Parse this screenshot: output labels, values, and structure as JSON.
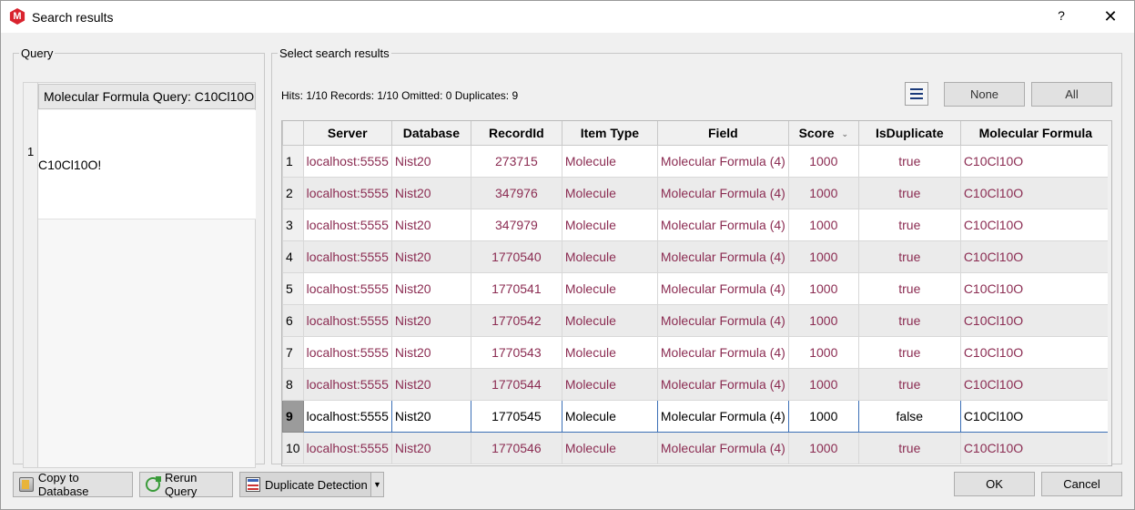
{
  "window": {
    "title": "Search results",
    "help_label": "?",
    "close_label": "✕"
  },
  "query": {
    "legend": "Query",
    "column_header": "Molecular Formula Query: C10Cl10O",
    "row_number": "1",
    "cell_value": "C10Cl10O!"
  },
  "results": {
    "legend": "Select search results",
    "hits_summary": "Hits: 1/10 Records: 1/10  Omitted: 0  Duplicates: 9",
    "menu_icon": "hamburger-menu-icon",
    "none_label": "None",
    "all_label": "All",
    "columns": [
      "Server",
      "Database",
      "RecordId",
      "Item Type",
      "Field",
      "Score",
      "IsDuplicate",
      "Molecular Formula"
    ],
    "sorted_column": "Score",
    "selected_row": "9",
    "rows": [
      {
        "num": "1",
        "server": "localhost:5555",
        "database": "Nist20",
        "record_id": "273715",
        "item_type": "Molecule",
        "field": "Molecular Formula (4)",
        "score": "1000",
        "is_duplicate": "true",
        "formula": "C10Cl10O"
      },
      {
        "num": "2",
        "server": "localhost:5555",
        "database": "Nist20",
        "record_id": "347976",
        "item_type": "Molecule",
        "field": "Molecular Formula (4)",
        "score": "1000",
        "is_duplicate": "true",
        "formula": "C10Cl10O"
      },
      {
        "num": "3",
        "server": "localhost:5555",
        "database": "Nist20",
        "record_id": "347979",
        "item_type": "Molecule",
        "field": "Molecular Formula (4)",
        "score": "1000",
        "is_duplicate": "true",
        "formula": "C10Cl10O"
      },
      {
        "num": "4",
        "server": "localhost:5555",
        "database": "Nist20",
        "record_id": "1770540",
        "item_type": "Molecule",
        "field": "Molecular Formula (4)",
        "score": "1000",
        "is_duplicate": "true",
        "formula": "C10Cl10O"
      },
      {
        "num": "5",
        "server": "localhost:5555",
        "database": "Nist20",
        "record_id": "1770541",
        "item_type": "Molecule",
        "field": "Molecular Formula (4)",
        "score": "1000",
        "is_duplicate": "true",
        "formula": "C10Cl10O"
      },
      {
        "num": "6",
        "server": "localhost:5555",
        "database": "Nist20",
        "record_id": "1770542",
        "item_type": "Molecule",
        "field": "Molecular Formula (4)",
        "score": "1000",
        "is_duplicate": "true",
        "formula": "C10Cl10O"
      },
      {
        "num": "7",
        "server": "localhost:5555",
        "database": "Nist20",
        "record_id": "1770543",
        "item_type": "Molecule",
        "field": "Molecular Formula (4)",
        "score": "1000",
        "is_duplicate": "true",
        "formula": "C10Cl10O"
      },
      {
        "num": "8",
        "server": "localhost:5555",
        "database": "Nist20",
        "record_id": "1770544",
        "item_type": "Molecule",
        "field": "Molecular Formula (4)",
        "score": "1000",
        "is_duplicate": "true",
        "formula": "C10Cl10O"
      },
      {
        "num": "9",
        "server": "localhost:5555",
        "database": "Nist20",
        "record_id": "1770545",
        "item_type": "Molecule",
        "field": "Molecular Formula (4)",
        "score": "1000",
        "is_duplicate": "false",
        "formula": "C10Cl10O"
      },
      {
        "num": "10",
        "server": "localhost:5555",
        "database": "Nist20",
        "record_id": "1770546",
        "item_type": "Molecule",
        "field": "Molecular Formula (4)",
        "score": "1000",
        "is_duplicate": "true",
        "formula": "C10Cl10O"
      }
    ]
  },
  "footer": {
    "copy_label": "Copy to Database",
    "rerun_label": "Rerun Query",
    "duplicate_label": "Duplicate Detection",
    "dropdown_icon": "chevron-down-icon",
    "ok_label": "OK",
    "cancel_label": "Cancel"
  },
  "colors": {
    "duplicate_text": "#8b2c52",
    "selection_border": "#3b6fb6",
    "app_icon": "#d9232e"
  }
}
